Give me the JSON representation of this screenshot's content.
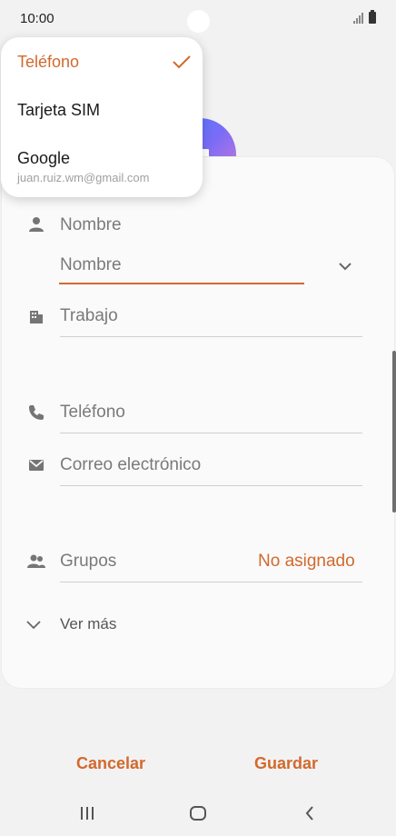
{
  "status_bar": {
    "time": "10:00"
  },
  "dropdown": {
    "items": [
      {
        "label": "Teléfono",
        "selected": true
      },
      {
        "label": "Tarjeta SIM",
        "selected": false
      },
      {
        "label": "Google",
        "sublabel": "juan.ruiz.wm@gmail.com",
        "selected": false
      }
    ]
  },
  "form": {
    "name_label": "Nombre",
    "name_field_placeholder": "Nombre",
    "work_label": "Trabajo",
    "phone_label": "Teléfono",
    "email_label": "Correo electrónico",
    "groups_label": "Grupos",
    "groups_value": "No asignado",
    "see_more_label": "Ver más"
  },
  "actions": {
    "cancel_label": "Cancelar",
    "save_label": "Guardar"
  },
  "colors": {
    "accent": "#d2692d",
    "background": "#f2f2f2",
    "card": "#fafafa"
  },
  "icons": {
    "person": "person-icon",
    "building": "building-icon",
    "phone": "phone-icon",
    "mail": "mail-icon",
    "groups": "groups-icon"
  }
}
